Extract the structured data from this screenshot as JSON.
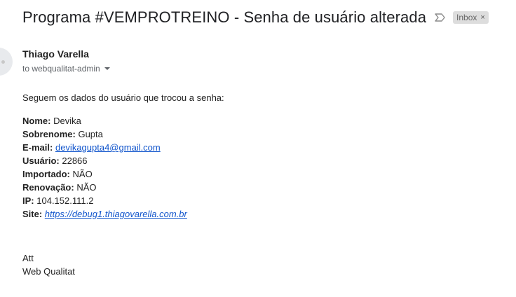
{
  "header": {
    "subject": "Programa #VEMPROTREINO - Senha de usuário alterada",
    "label": "Inbox",
    "label_close": "×"
  },
  "icons": {
    "importance": "importance-marker-icon",
    "avatar": "avatar",
    "label_close": "close-icon",
    "recipient_dropdown": "chevron-down-icon"
  },
  "sender": {
    "name": "Thiago Varella",
    "recipient_line": "to webqualitat-admin"
  },
  "message": {
    "intro": "Seguem os dados do usuário que trocou a senha:",
    "fields": [
      {
        "label": "Nome:",
        "value": "Devika"
      },
      {
        "label": "Sobrenome:",
        "value": "Gupta"
      },
      {
        "label": "E-mail:",
        "value": "devikagupta4@gmail.com"
      },
      {
        "label": "Usuário:",
        "value": "22866"
      },
      {
        "label": "Importado:",
        "value": "NÃO"
      },
      {
        "label": "Renovação:",
        "value": "NÃO"
      },
      {
        "label": "IP:",
        "value": "104.152.111.2"
      },
      {
        "label": "Site:",
        "value": "https://debug1.thiagovarella.com.br"
      }
    ],
    "signoff_line1": "Att",
    "signoff_line2": "Web Qualitat"
  },
  "colors": {
    "link": "#1155cc",
    "chip_bg": "#dddddd",
    "text": "#222222"
  }
}
